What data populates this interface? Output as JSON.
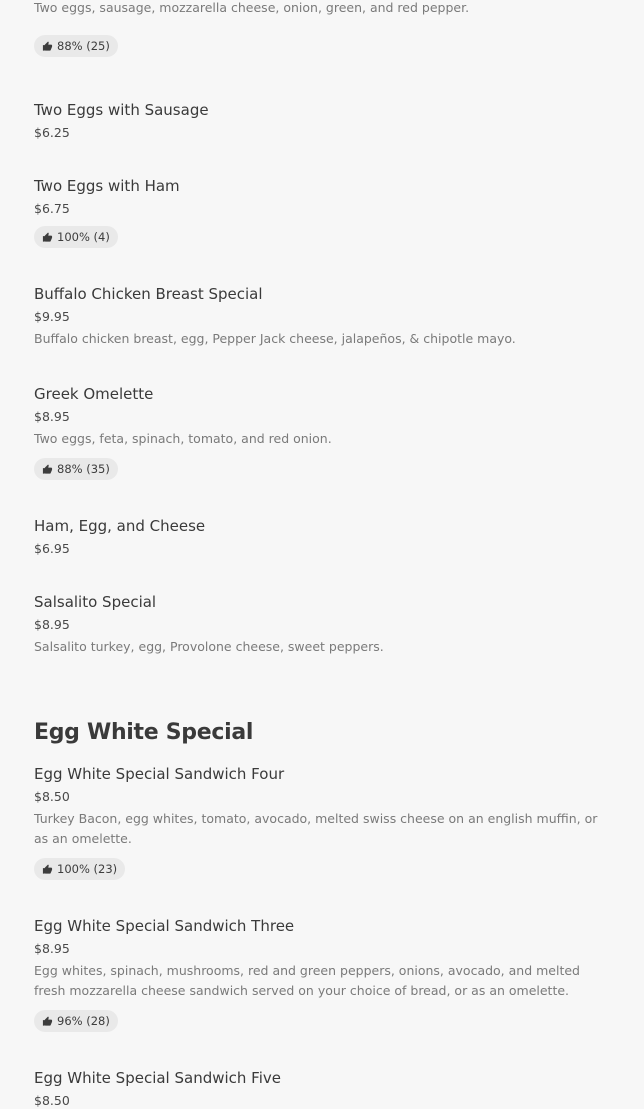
{
  "items_top": [
    {
      "desc": "Two eggs, sausage, mozzarella cheese, onion, green, and red pepper.",
      "rating": "88% (25)"
    },
    {
      "title": "Two Eggs with Sausage",
      "price": "$6.25"
    },
    {
      "title": "Two Eggs with Ham",
      "price": "$6.75",
      "rating": "100% (4)"
    },
    {
      "title": "Buffalo Chicken Breast Special",
      "price": "$9.95",
      "desc": "Buffalo chicken breast, egg, Pepper Jack cheese, jalapeños, & chipotle mayo."
    },
    {
      "title": "Greek Omelette",
      "price": "$8.95",
      "desc": "Two eggs, feta, spinach, tomato, and red onion.",
      "rating": "88% (35)"
    },
    {
      "title": "Ham, Egg, and Cheese",
      "price": "$6.95"
    },
    {
      "title": "Salsalito Special",
      "price": "$8.95",
      "desc": "Salsalito turkey, egg, Provolone cheese, sweet peppers."
    }
  ],
  "section": {
    "heading": "Egg White Special",
    "items": [
      {
        "title": "Egg White Special Sandwich Four",
        "price": "$8.50",
        "desc": "Turkey Bacon, egg whites, tomato, avocado, melted swiss cheese on an english muffin, or as an omelette.",
        "rating": "100% (23)"
      },
      {
        "title": "Egg White Special Sandwich Three",
        "price": "$8.95",
        "desc": "Egg whites, spinach, mushrooms, red and green peppers, onions, avocado, and melted fresh mozzarella cheese sandwich served on your choice of bread, or as an omelette.",
        "rating": "96% (28)"
      },
      {
        "title": "Egg White Special Sandwich Five",
        "price": "$8.50"
      }
    ]
  },
  "icons": {
    "rating": "thumbs-up-icon"
  }
}
